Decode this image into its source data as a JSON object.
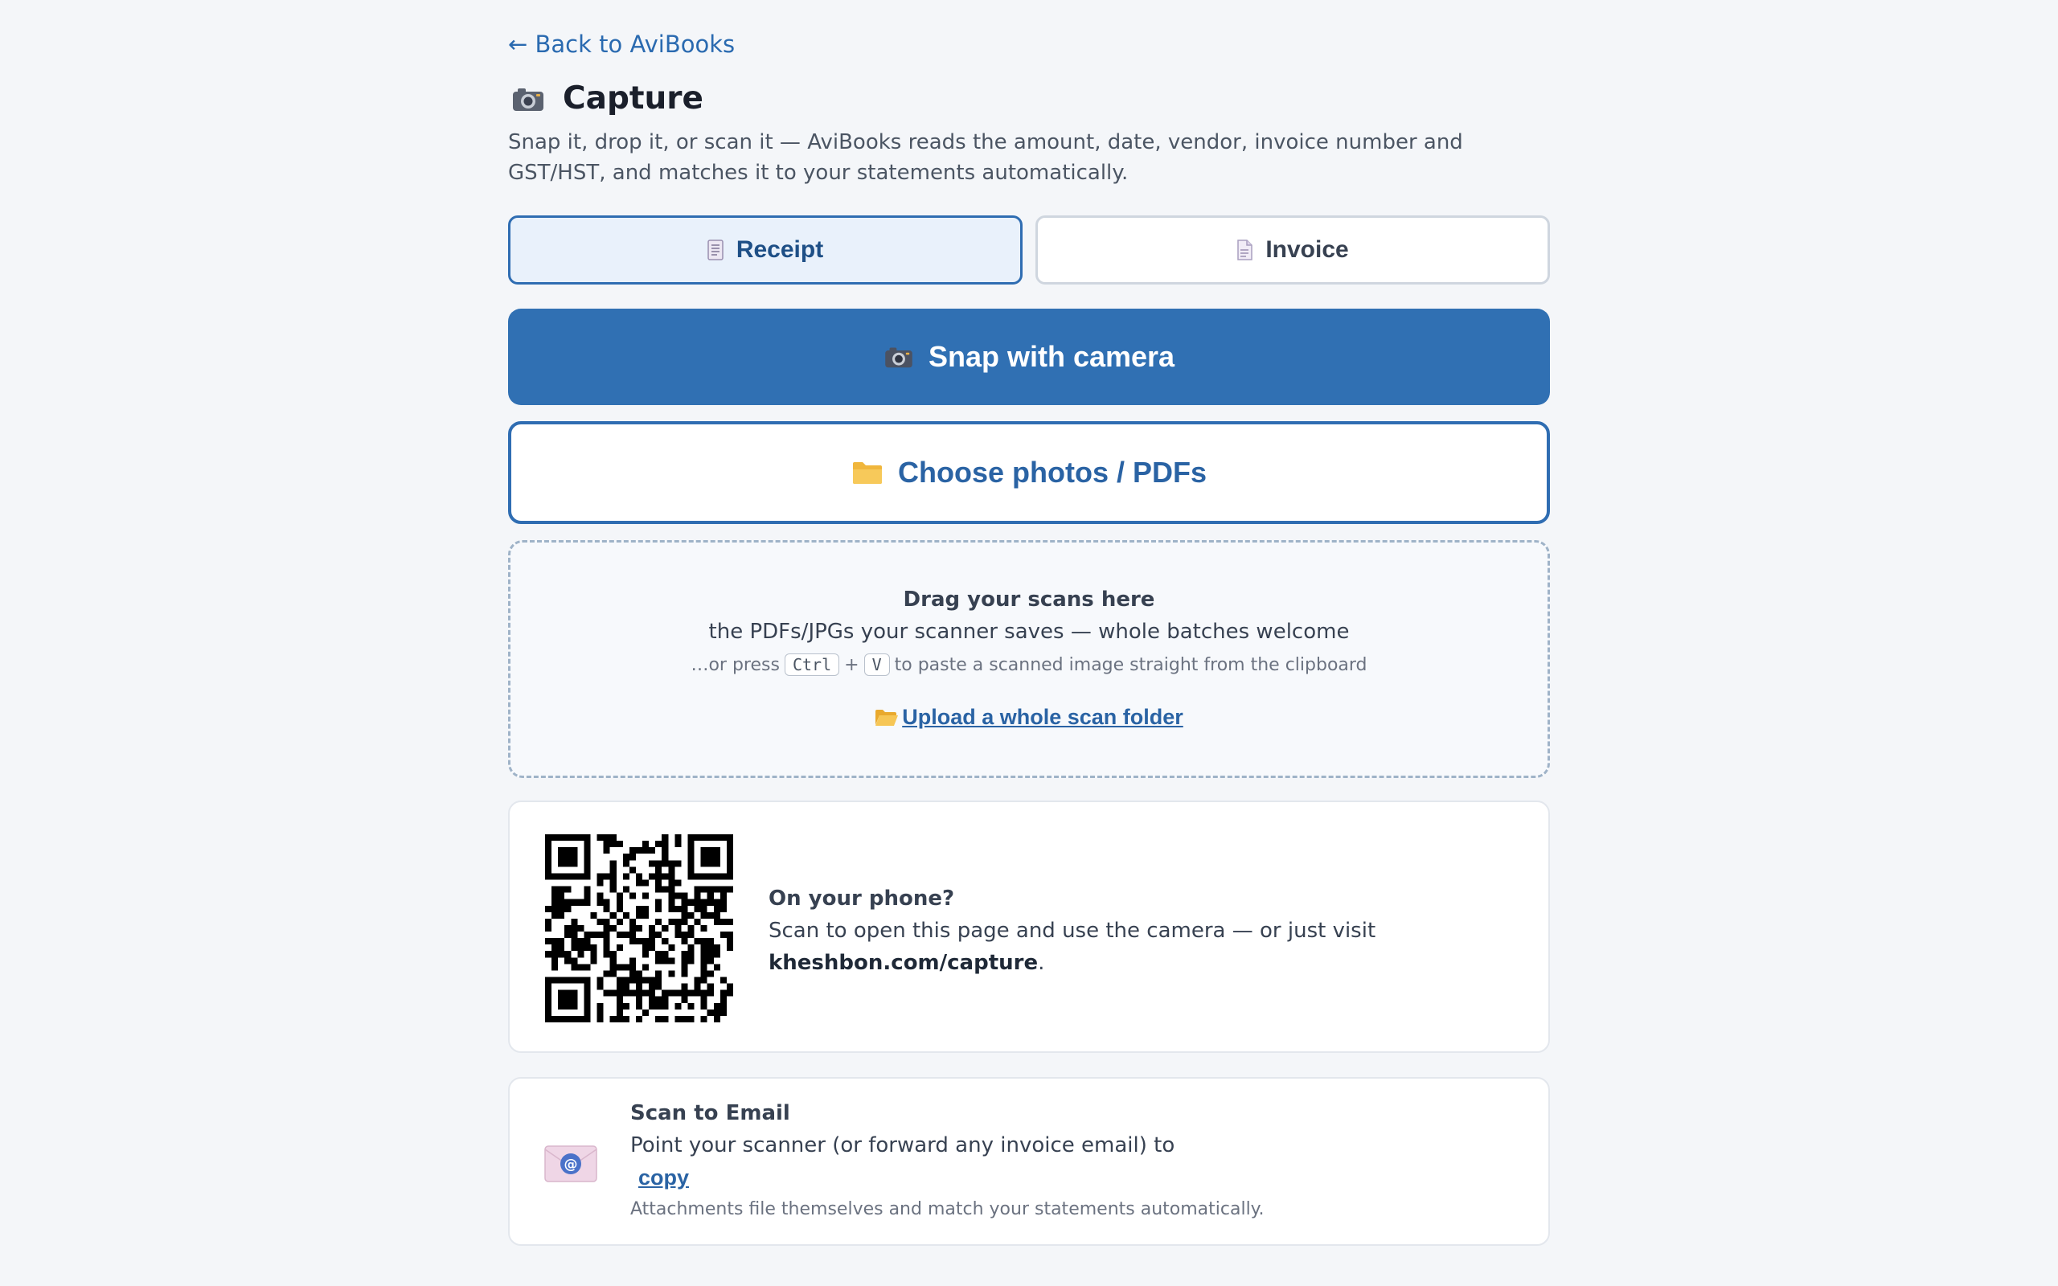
{
  "nav": {
    "back_label": "← Back to AviBooks"
  },
  "header": {
    "title": "Capture",
    "subtitle": "Snap it, drop it, or scan it — AviBooks reads the amount, date, vendor, invoice number and GST/HST, and matches it to your statements automatically."
  },
  "doc_type": {
    "options": [
      {
        "label": "Receipt",
        "selected": true,
        "icon": "receipt-icon"
      },
      {
        "label": "Invoice",
        "selected": false,
        "icon": "invoice-icon"
      }
    ]
  },
  "actions": {
    "snap_label": "Snap with camera",
    "choose_label": "Choose photos / PDFs"
  },
  "dropzone": {
    "title": "Drag your scans here",
    "subtitle": "the PDFs/JPGs your scanner saves — whole batches welcome",
    "paste_prefix": "…or press",
    "key_ctrl": "Ctrl",
    "plus": "+",
    "key_v": "V",
    "paste_suffix": "to paste a scanned image straight from the clipboard",
    "folder_label": "Upload a whole scan folder"
  },
  "phone": {
    "title": "On your phone?",
    "desc": "Scan to open this page and use the camera — or just visit",
    "url": "kheshbon.com/capture",
    "url_suffix": "."
  },
  "email": {
    "title": "Scan to Email",
    "desc": "Point your scanner (or forward any invoice email) to",
    "copy_label": "copy",
    "note": "Attachments file themselves and match your statements automatically."
  },
  "colors": {
    "accent": "#3070b3",
    "link": "#2a6ab0",
    "background": "#f4f6f9"
  }
}
